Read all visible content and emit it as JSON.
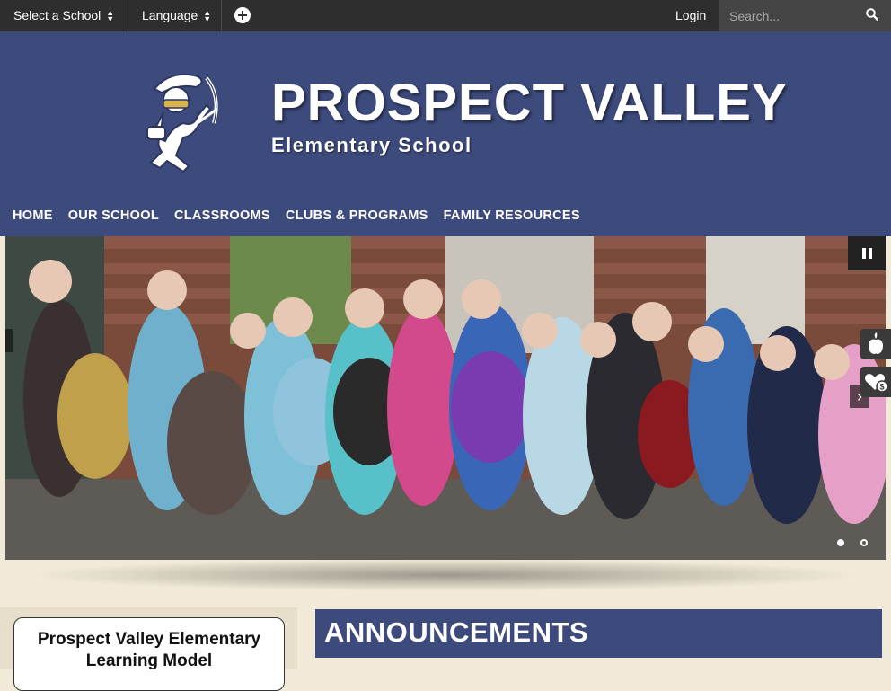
{
  "topbar": {
    "select_school": "Select a School",
    "language": "Language",
    "login": "Login",
    "search_placeholder": "Search..."
  },
  "header": {
    "title": "PROSPECT VALLEY",
    "subtitle": "Elementary School"
  },
  "nav": [
    "HOME",
    "OUR SCHOOL",
    "CLASSROOMS",
    "CLUBS & PROGRAMS",
    "FAMILY RESOURCES"
  ],
  "slider": {
    "slide_count": 2,
    "active_slide": 1
  },
  "learning_model": {
    "label": "Prospect Valley Elementary Learning Model"
  },
  "announcements": {
    "heading": "ANNOUNCEMENTS"
  },
  "colors": {
    "brand": "#3d4a7c",
    "topbar": "#2e2e2e",
    "page_bg": "#f1ead8"
  }
}
